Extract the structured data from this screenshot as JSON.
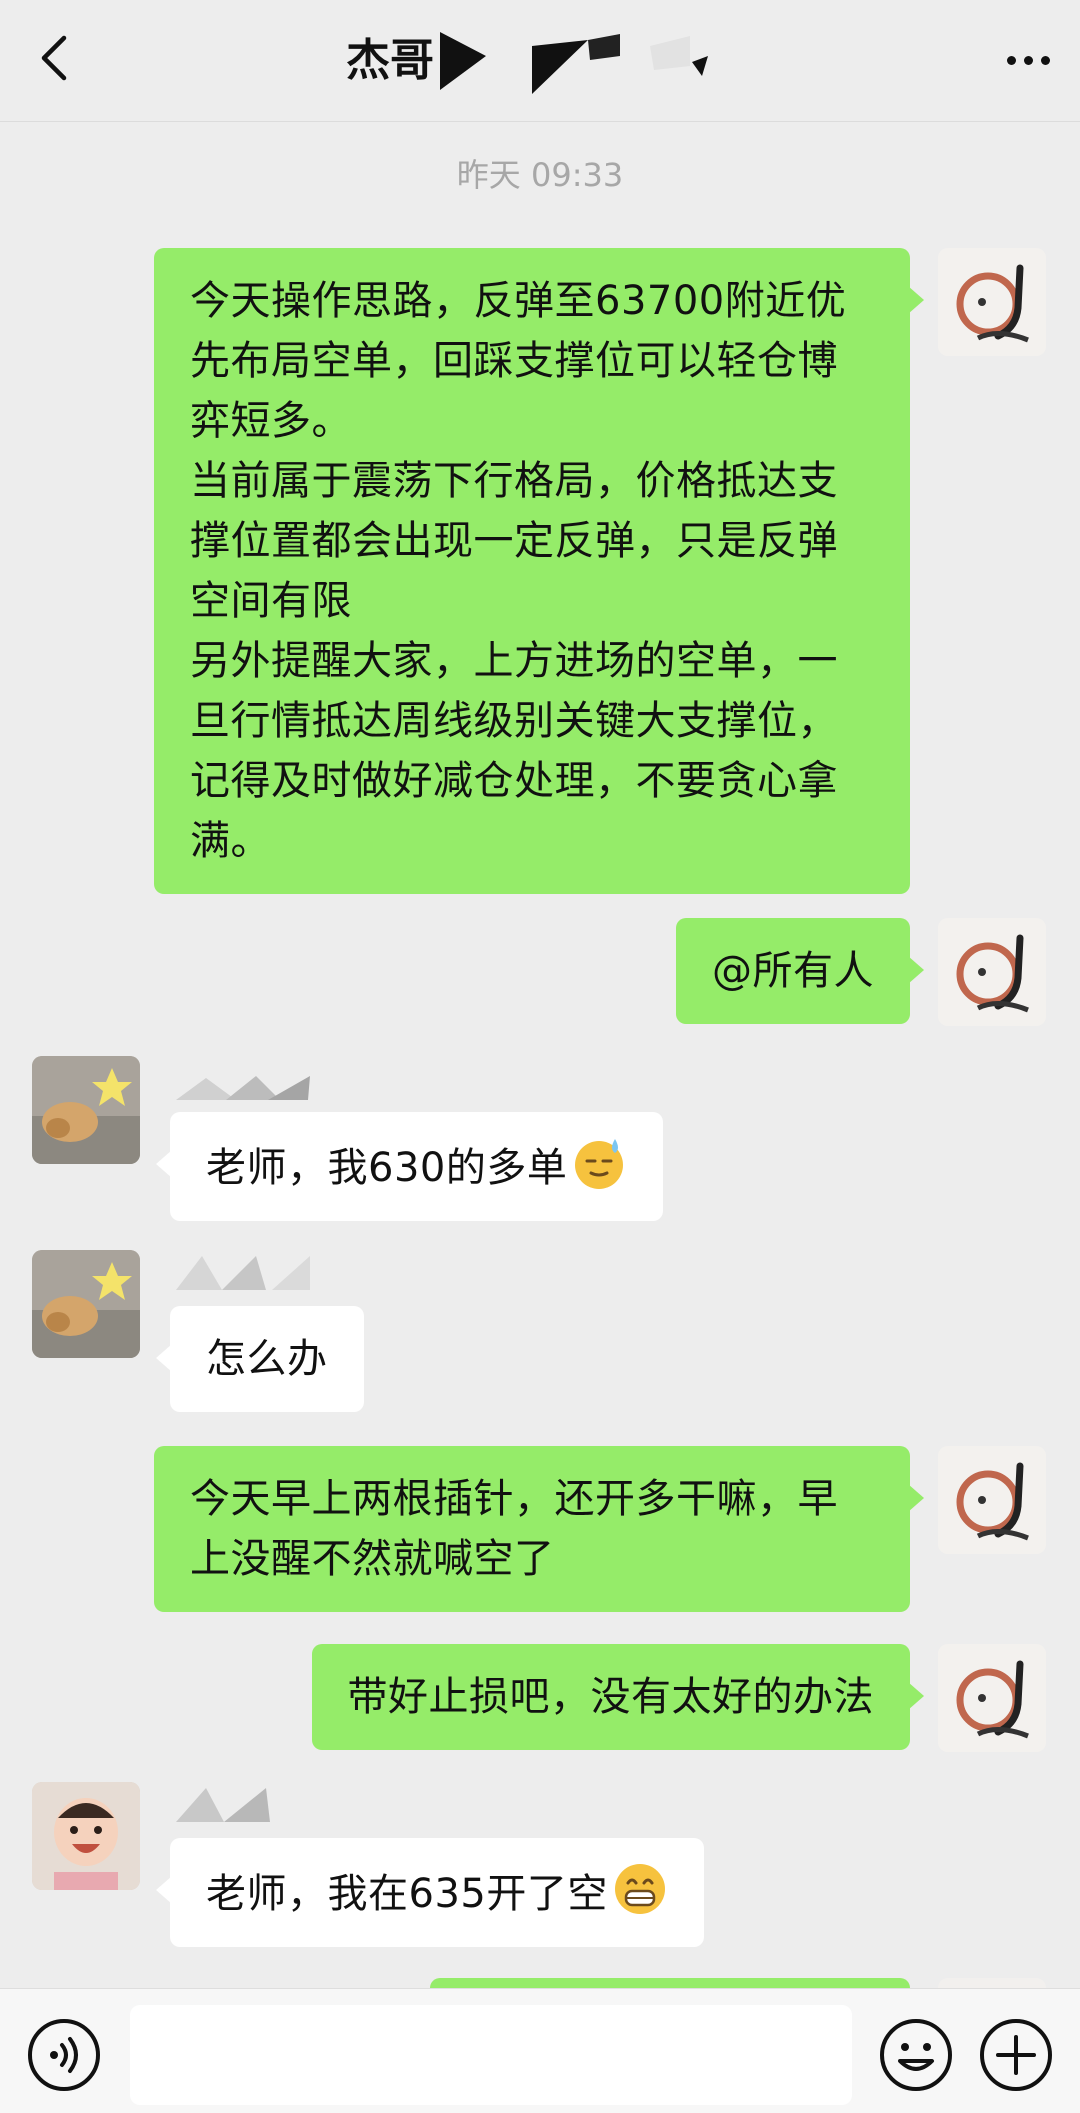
{
  "header": {
    "title": "杰哥",
    "back_icon": "chevron-left-icon",
    "more_icon": "more-dots-icon"
  },
  "timestamp": "昨天 09:33",
  "messages": [
    {
      "side": "out",
      "text": "今天操作思路，反弹至63700附近优先布局空单，回踩支撑位可以轻仓博弈短多。\n当前属于震荡下行格局，价格抵达支撑位置都会出现一定反弹，只是反弹空间有限\n另外提醒大家，上方进场的空单，一旦行情抵达周线级别关键大支撑位，记得及时做好减仓处理，不要贪心拿满。"
    },
    {
      "side": "out",
      "text": "@所有人"
    },
    {
      "side": "in",
      "text": "老师，我630的多单",
      "emoji": "sweat-smile-emoji"
    },
    {
      "side": "in",
      "text": "怎么办"
    },
    {
      "side": "out",
      "text": "今天早上两根插针，还开多干嘛，早上没醒不然就喊空了"
    },
    {
      "side": "out",
      "text": "带好止损吧，没有太好的办法"
    },
    {
      "side": "in",
      "text": "老师，我在635开了空",
      "emoji": "grin-emoji"
    }
  ],
  "input_bar": {
    "voice_icon": "voice-icon",
    "emoji_icon": "smiley-icon",
    "plus_icon": "plus-circle-icon",
    "input_value": ""
  },
  "colors": {
    "outgoing_bubble": "#95ec69",
    "incoming_bubble": "#ffffff",
    "background": "#ededed"
  }
}
